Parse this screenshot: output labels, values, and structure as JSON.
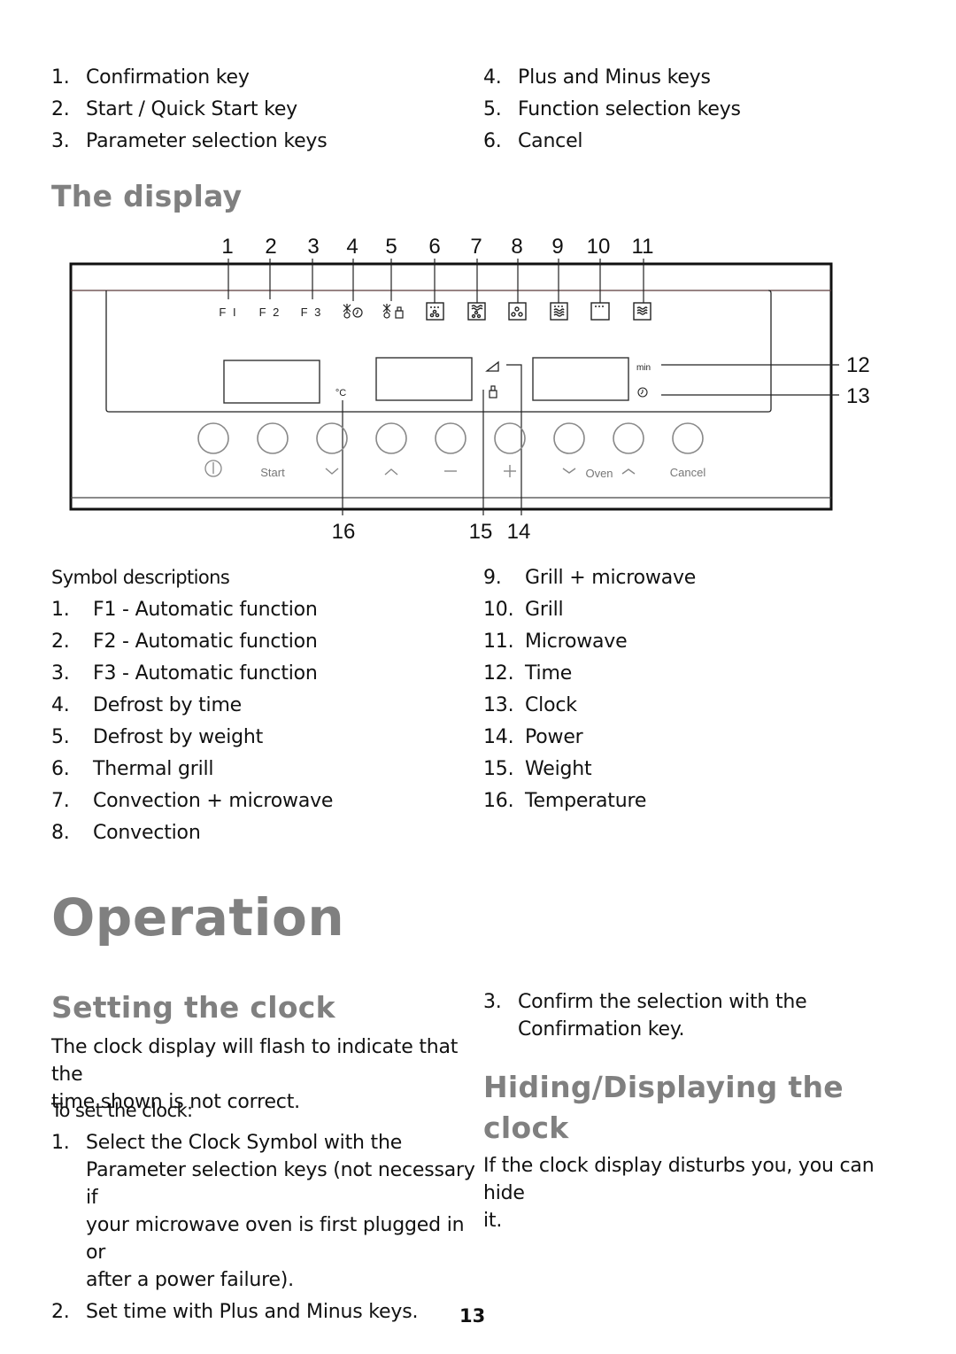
{
  "keys_list": {
    "left": [
      {
        "num": "1.",
        "label": "Confirmation key"
      },
      {
        "num": "2.",
        "label": "Start / Quick Start key"
      },
      {
        "num": "3.",
        "label": "Parameter selection keys"
      }
    ],
    "right": [
      {
        "num": "4.",
        "label": "Plus and Minus keys"
      },
      {
        "num": "5.",
        "label": "Function selection keys"
      },
      {
        "num": "6.",
        "label": "Cancel"
      }
    ]
  },
  "display_section": {
    "title": "The display"
  },
  "diagram": {
    "top_callouts": [
      "1",
      "2",
      "3",
      "4",
      "5",
      "6",
      "7",
      "8",
      "9",
      "10",
      "11"
    ],
    "right_callouts": [
      "12",
      "13"
    ],
    "bottom_callouts": [
      "16",
      "15",
      "14"
    ],
    "function_labels": [
      "F I",
      "F 2",
      "F 3"
    ],
    "unit_celsius": "°C",
    "unit_min": "min",
    "key_labels": {
      "start": "Start",
      "oven": "Oven",
      "cancel": "Cancel",
      "plus": "+",
      "minus": "—"
    }
  },
  "symbol_descriptions": {
    "heading": "Symbol descriptions",
    "left": [
      {
        "num": "1.",
        "label": "F1 - Automatic function"
      },
      {
        "num": "2.",
        "label": "F2 - Automatic function"
      },
      {
        "num": "3.",
        "label": "F3 - Automatic function"
      },
      {
        "num": "4.",
        "label": "Defrost by time"
      },
      {
        "num": "5.",
        "label": "Defrost by weight"
      },
      {
        "num": "6.",
        "label": "Thermal grill"
      },
      {
        "num": "7.",
        "label": "Convection + microwave"
      },
      {
        "num": "8.",
        "label": "Convection"
      }
    ],
    "right": [
      {
        "num": "9.",
        "label": "Grill + microwave"
      },
      {
        "num": "10.",
        "label": "Grill"
      },
      {
        "num": "11.",
        "label": "Microwave"
      },
      {
        "num": "12.",
        "label": "Time"
      },
      {
        "num": "13.",
        "label": "Clock"
      },
      {
        "num": "14.",
        "label": "Power"
      },
      {
        "num": "15.",
        "label": "Weight"
      },
      {
        "num": "16.",
        "label": "Temperature"
      }
    ]
  },
  "operation": {
    "title": "Operation",
    "setting_clock": {
      "title": "Setting the clock",
      "intro_line1": "The clock display will flash to indicate that the",
      "intro_line2": "time shown is not correct.",
      "subheading": "To set the clock:",
      "steps": [
        {
          "num": "1.",
          "lines": [
            "Select the Clock Symbol with the",
            "Parameter selection keys (not necessary if",
            "your microwave oven is first plugged in or",
            "after a power failure)."
          ]
        },
        {
          "num": "2.",
          "lines": [
            "Set time with Plus and Minus keys."
          ]
        },
        {
          "num": "3.",
          "lines": [
            "Confirm the selection with the",
            "Confirmation key."
          ]
        }
      ]
    },
    "hiding_clock": {
      "title_line1": "Hiding/Displaying the",
      "title_line2": "clock",
      "text_line1": "If the clock display disturbs you, you can hide",
      "text_line2": "it."
    }
  },
  "footer": {
    "page_number": "13"
  }
}
